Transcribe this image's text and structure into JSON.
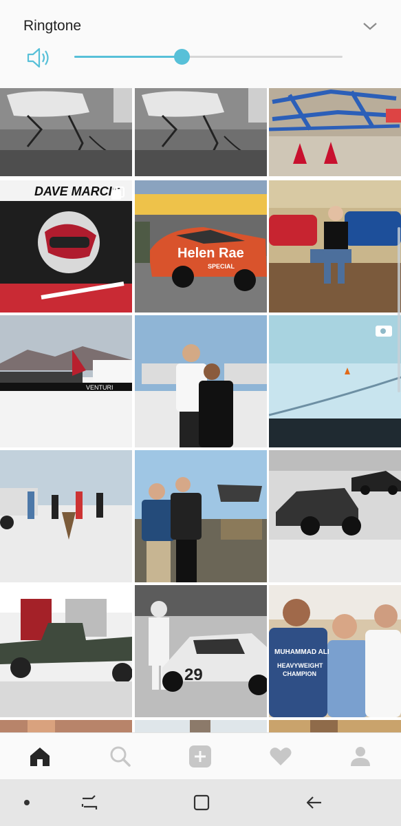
{
  "volume_panel": {
    "title": "Ringtone",
    "level": 0.4,
    "accent_color": "#57c0d8",
    "icons": [
      "speaker-icon",
      "chevron-down-icon"
    ]
  },
  "bottom_nav": {
    "items": [
      "home-icon",
      "search-icon",
      "add-post-icon",
      "heart-icon",
      "profile-icon"
    ],
    "active": "home"
  },
  "system_bar": {
    "items": [
      "dot-icon",
      "recent-apps-icon",
      "home-square-icon",
      "back-icon"
    ]
  },
  "photo_tags": {
    "dave_marcis_helmet": "DAVE MARCIS",
    "helen_rae_car": "Helen Rae",
    "helen_rae_special": "SPECIAL",
    "trailer_text": "VENTURI",
    "car_29": "29",
    "ali_shirt_line1": "MUHAMMAD ALI",
    "ali_shirt_line2": "HEAVYWEIGHT",
    "ali_shirt_line3": "CHAMPION"
  }
}
